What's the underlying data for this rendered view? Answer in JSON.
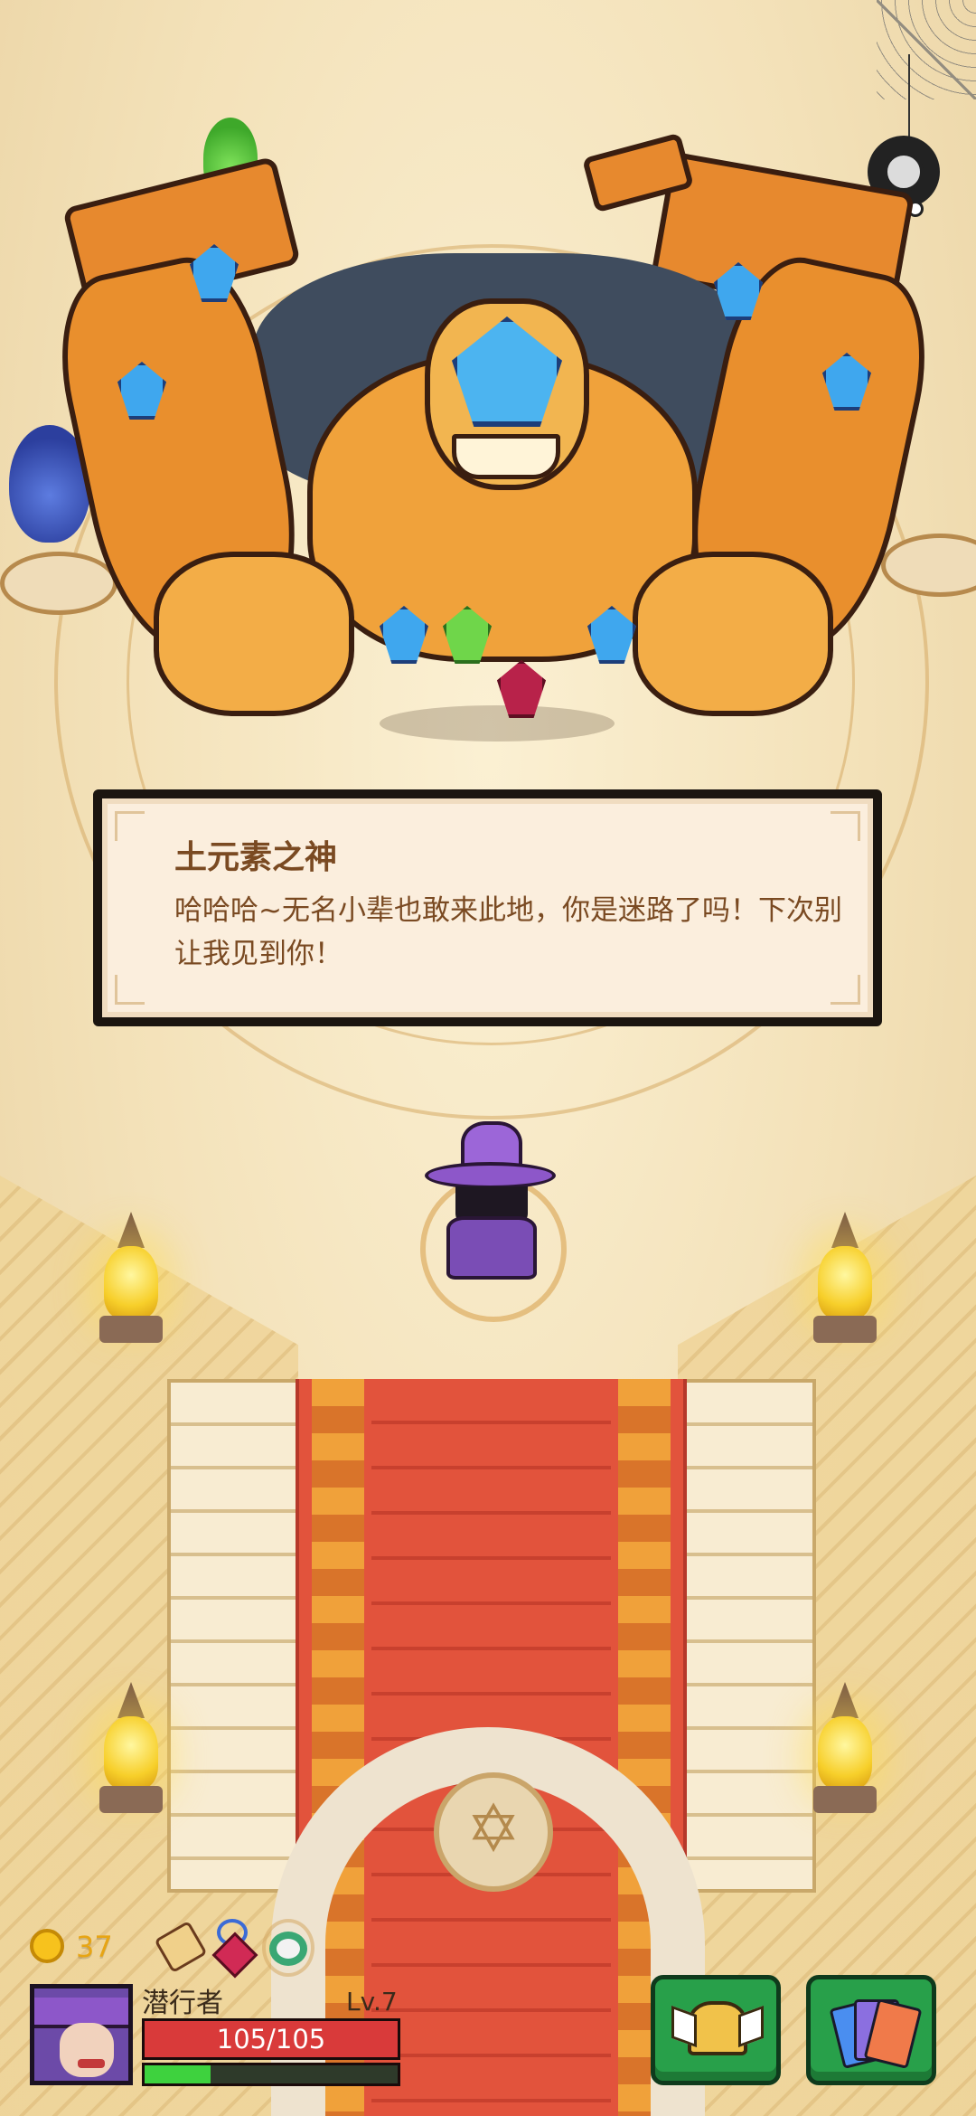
{
  "dialog": {
    "speaker": "土元素之神",
    "text": "哈哈哈~无名小辈也敢来此地，你是迷路了吗！下次别让我见到你！"
  },
  "hud": {
    "coins": "37",
    "character_name": "潜行者",
    "level": "Lv.7",
    "hp_text": "105/105",
    "hp_fraction": 1.0,
    "xp_fraction": 0.26,
    "items": [
      "scroll-icon",
      "heart-amulet-icon",
      "ring-icon"
    ],
    "buttons": [
      "equipment-helmet-button",
      "cards-button"
    ]
  },
  "colors": {
    "hp": "#d93a3a",
    "xp": "#3ed23e",
    "button_green": "#28a04a",
    "coin": "#f7c21d"
  }
}
